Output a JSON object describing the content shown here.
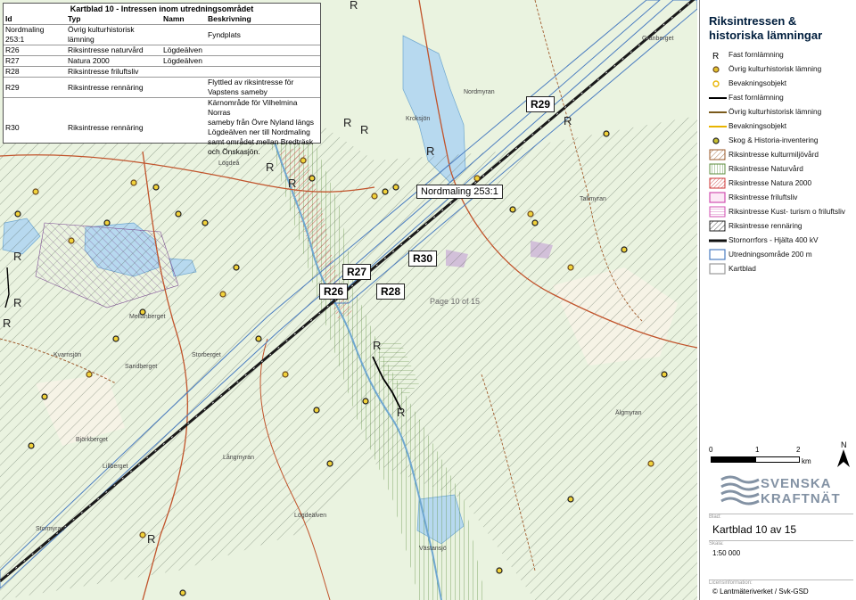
{
  "attribute_table": {
    "title": "Kartblad 10 - Intressen inom utredningsområdet",
    "headers": {
      "id": "Id",
      "typ": "Typ",
      "namn": "Namn",
      "beskrivning": "Beskrivning"
    },
    "rows": [
      {
        "id": "Nordmaling 253:1",
        "typ": "Övrig kulturhistorisk lämning",
        "namn": "",
        "beskrivning": "Fyndplats"
      },
      {
        "id": "R26",
        "typ": "Riksintresse naturvård",
        "namn": "Lögdeälven",
        "beskrivning": ""
      },
      {
        "id": "R27",
        "typ": "Natura 2000",
        "namn": "Lögdeälven",
        "beskrivning": ""
      },
      {
        "id": "R28",
        "typ": "Riksintresse friluftsliv",
        "namn": "",
        "beskrivning": ""
      },
      {
        "id": "R29",
        "typ": "Riksintresse rennäring",
        "namn": "",
        "beskrivning": "Flyttled av riksintresse för\nVapstens sameby"
      },
      {
        "id": "R30",
        "typ": "Riksintresse rennäring",
        "namn": "",
        "beskrivning": "Kärnområde för Vilhelmina Norras\nsameby från Övre Nyland längs\nLögdeälven ner till Nordmaling\nsamt området mellan Bredträsk\noch Önskasjön."
      }
    ]
  },
  "map": {
    "callouts": [
      "R26",
      "R27",
      "R28",
      "R29",
      "R30",
      "Nordmaling 253:1"
    ],
    "fornlamning_letter": "R",
    "page_text": "Page 10 of 15",
    "places": [
      "Kvarnsjön",
      "Nordmyran",
      "Lögdeå",
      "Stormyran",
      "Långmyran",
      "Storberget",
      "Lillberget",
      "Tallmyran",
      "Björkberget",
      "Kroksjön",
      "Älgmyran",
      "Sandberget",
      "Lögdeälven",
      "Västansjö",
      "Mellanberget",
      "Granberget"
    ]
  },
  "legend": {
    "title": "Riksintressen & historiska lämningar",
    "items": [
      {
        "label": "Fast fornlämning",
        "symbol": "R-letter"
      },
      {
        "label": "Övrig kulturhistorisk lämning",
        "symbol": "brown-dot"
      },
      {
        "label": "Bevakningsobjekt",
        "symbol": "yellow-dot"
      },
      {
        "label": "Fast fornlämning",
        "symbol": "black-line"
      },
      {
        "label": "Övrig kulturhistorisk lämning",
        "symbol": "brown-line"
      },
      {
        "label": "Bevakningsobjekt",
        "symbol": "yellow-line"
      },
      {
        "label": "Skog & Historia-inventering",
        "symbol": "olive-dot"
      },
      {
        "label": "Riksintresse kulturmiljövård",
        "symbol": "brown-hatch"
      },
      {
        "label": "Riksintresse Naturvård",
        "symbol": "green-vertical"
      },
      {
        "label": "Riksintresse Natura 2000",
        "symbol": "red-hatch"
      },
      {
        "label": "Riksintresse friluftsliv",
        "symbol": "pink-box"
      },
      {
        "label": "Riksintresse Kust- turism o friluftsliv",
        "symbol": "pink-lines"
      },
      {
        "label": "Riksintresse rennäring",
        "symbol": "black-hatch"
      },
      {
        "label": "Stornorrfors - Hjälta 400 kV",
        "symbol": "powerline"
      },
      {
        "label": "Utredningsområde 200 m",
        "symbol": "blue-box"
      },
      {
        "label": "Kartblad",
        "symbol": "grey-box"
      }
    ],
    "scale": {
      "ticks": [
        "0",
        "1",
        "2"
      ],
      "unit": "km",
      "north": "N"
    },
    "logo": {
      "line1": "SVENSKA",
      "line2": "KRAFTNÄT"
    },
    "blad_label": "Blad:",
    "blad_value": "Kartblad 10 av 15",
    "skala_label": "Skala:",
    "skala_value": "1:50 000",
    "kalla_label": "Licensinformation:",
    "kalla_value": "© Lantmäteriverket / Svk-GSD"
  },
  "colors": {
    "forest": "#eaf3e0",
    "water": "#b7d9ef",
    "wetland": "#c8a9d6",
    "powerline": "#1a1a1a",
    "corridor": "#4b7dc0",
    "rennaring": "#2e4a3e",
    "naturvard": "#6c9a4e",
    "natura2000": "#cc3333",
    "road": "#c1532b",
    "brand": "#001e3d"
  }
}
